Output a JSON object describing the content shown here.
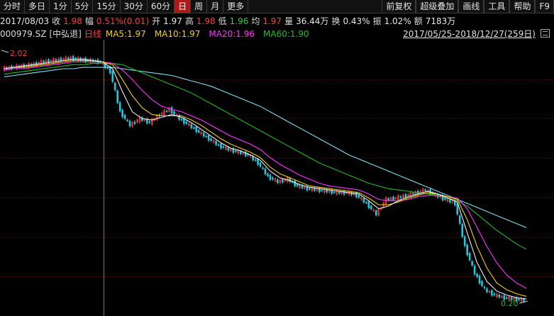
{
  "toolbar": {
    "items": [
      "分时",
      "多日",
      "1分",
      "5分",
      "15分",
      "30分",
      "60分",
      "日",
      "周",
      "月",
      "更多"
    ],
    "active_index": 7,
    "right_items": [
      "前复权",
      "超级叠加",
      "画线",
      "工具",
      "帮助",
      "F9"
    ]
  },
  "info": {
    "date": "2017/08/03",
    "close_label": "收",
    "close": "1.98",
    "change_label": "幅",
    "change": "0.51%(0.01)",
    "open_label": "开",
    "open": "1.97",
    "high_label": "高",
    "high": "1.98",
    "low_label": "低",
    "low": "1.96",
    "avg_label": "均",
    "avg": "1.97",
    "volume_label": "量",
    "volume": "36.44万",
    "turnover_label": "换",
    "turnover": "0.43%",
    "amplitude_label": "振",
    "amplitude": "1.02%",
    "amount_label": "额",
    "amount": "7183万"
  },
  "ma_row": {
    "code": "000979.SZ",
    "name": "[中弘退]",
    "period": "日线",
    "ma5": "MA5:1.97",
    "ma10": "MA10:1.97",
    "ma20": "MA20:1.96",
    "ma60": "MA60:1.90",
    "range": "2017/05/25-2018/12/27(259日)"
  },
  "colors": {
    "up": "#ff3b3b",
    "down": "#23c8e0",
    "ma5": "#f0f0f0",
    "ma10": "#f5d000",
    "ma20": "#ff33ff",
    "ma60": "#22bb22",
    "ma120": "#7fe0f0",
    "grid": "#8b0000"
  },
  "chart_data": {
    "type": "candlestick",
    "max_label": "2.02",
    "min_label": "0.20",
    "max_value": 2.02,
    "min_value": 0.2,
    "series_price": [
      1.92,
      1.93,
      1.94,
      1.95,
      1.97,
      1.98,
      1.99,
      2.0,
      1.99,
      1.98,
      1.97,
      1.9,
      1.6,
      1.5,
      1.55,
      1.52,
      1.58,
      1.62,
      1.55,
      1.5,
      1.45,
      1.4,
      1.35,
      1.32,
      1.3,
      1.28,
      1.22,
      1.12,
      1.08,
      1.1,
      1.05,
      1.03,
      1.02,
      1.01,
      1.0,
      1.0,
      0.98,
      0.92,
      0.84,
      0.95,
      0.96,
      0.98,
      1.0,
      1.02,
      0.98,
      0.95,
      0.92,
      0.6,
      0.4,
      0.28,
      0.24,
      0.22,
      0.21,
      0.2
    ],
    "ma5": [
      1.92,
      1.93,
      1.94,
      1.95,
      1.96,
      1.97,
      1.98,
      1.99,
      1.99,
      1.98,
      1.97,
      1.92,
      1.75,
      1.6,
      1.55,
      1.54,
      1.56,
      1.58,
      1.56,
      1.52,
      1.47,
      1.42,
      1.37,
      1.33,
      1.31,
      1.28,
      1.24,
      1.16,
      1.11,
      1.09,
      1.06,
      1.04,
      1.03,
      1.02,
      1.01,
      1.0,
      0.99,
      0.94,
      0.88,
      0.9,
      0.94,
      0.97,
      0.99,
      1.01,
      0.99,
      0.96,
      0.93,
      0.7,
      0.48,
      0.34,
      0.27,
      0.24,
      0.22,
      0.21
    ],
    "ma10": [
      1.92,
      1.93,
      1.93,
      1.94,
      1.95,
      1.96,
      1.97,
      1.98,
      1.98,
      1.98,
      1.97,
      1.95,
      1.84,
      1.72,
      1.63,
      1.58,
      1.57,
      1.57,
      1.57,
      1.54,
      1.5,
      1.45,
      1.4,
      1.36,
      1.33,
      1.3,
      1.26,
      1.19,
      1.14,
      1.11,
      1.08,
      1.05,
      1.04,
      1.03,
      1.02,
      1.01,
      1.0,
      0.96,
      0.91,
      0.91,
      0.93,
      0.96,
      0.98,
      1.0,
      0.99,
      0.97,
      0.95,
      0.8,
      0.6,
      0.44,
      0.33,
      0.28,
      0.25,
      0.23
    ],
    "ma20": [
      1.91,
      1.92,
      1.92,
      1.93,
      1.94,
      1.95,
      1.96,
      1.97,
      1.97,
      1.97,
      1.97,
      1.96,
      1.91,
      1.84,
      1.76,
      1.69,
      1.64,
      1.62,
      1.6,
      1.57,
      1.54,
      1.5,
      1.46,
      1.42,
      1.39,
      1.36,
      1.32,
      1.26,
      1.21,
      1.17,
      1.13,
      1.1,
      1.07,
      1.05,
      1.04,
      1.03,
      1.02,
      0.99,
      0.95,
      0.94,
      0.94,
      0.95,
      0.97,
      0.98,
      0.98,
      0.97,
      0.96,
      0.88,
      0.74,
      0.6,
      0.48,
      0.39,
      0.33,
      0.29
    ],
    "ma60": [
      1.88,
      1.89,
      1.9,
      1.91,
      1.92,
      1.93,
      1.94,
      1.95,
      1.95,
      1.96,
      1.96,
      1.96,
      1.95,
      1.92,
      1.89,
      1.86,
      1.83,
      1.8,
      1.77,
      1.74,
      1.7,
      1.66,
      1.62,
      1.58,
      1.54,
      1.5,
      1.46,
      1.42,
      1.38,
      1.34,
      1.3,
      1.26,
      1.22,
      1.19,
      1.16,
      1.13,
      1.1,
      1.07,
      1.05,
      1.03,
      1.02,
      1.01,
      1.0,
      0.99,
      0.98,
      0.96,
      0.94,
      0.9,
      0.84,
      0.78,
      0.72,
      0.67,
      0.62,
      0.58
    ],
    "ma120": [
      1.86,
      1.87,
      1.88,
      1.89,
      1.9,
      1.91,
      1.92,
      1.92,
      1.93,
      1.93,
      1.93,
      1.93,
      1.92,
      1.91,
      1.9,
      1.89,
      1.88,
      1.87,
      1.85,
      1.83,
      1.81,
      1.79,
      1.76,
      1.73,
      1.7,
      1.67,
      1.64,
      1.6,
      1.56,
      1.52,
      1.48,
      1.44,
      1.4,
      1.36,
      1.32,
      1.28,
      1.25,
      1.22,
      1.19,
      1.16,
      1.13,
      1.1,
      1.07,
      1.04,
      1.01,
      0.98,
      0.95,
      0.92,
      0.89,
      0.86,
      0.83,
      0.8,
      0.77,
      0.74
    ]
  }
}
